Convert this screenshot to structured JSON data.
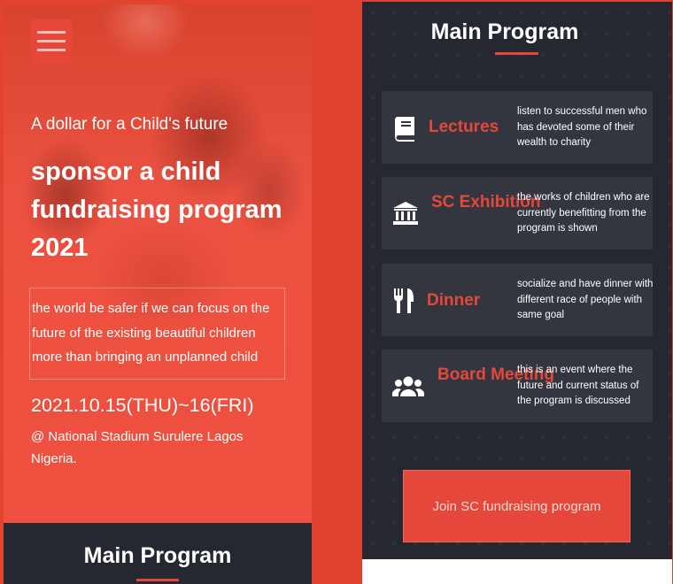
{
  "hero": {
    "tagline": "A dollar for a Child's future",
    "title": "sponsor a child fundraising program 2021",
    "text": "the world be safer if we can focus on the future of the existing beautiful children more than bringing an unplanned child",
    "date": "2021.10.15(THU)~16(FRI)",
    "venue": "@ National Stadium Surulere Lagos Nigeria."
  },
  "left_section": {
    "title": "Main Program"
  },
  "program": {
    "title": "Main Program",
    "items": [
      {
        "name": "Lectures",
        "icon": "book-icon",
        "description": "listen to successful men who has devoted some of their wealth to charity"
      },
      {
        "name": "SC Exhibition",
        "icon": "museum-icon",
        "description": "the works of children who are currently benefitting from the program is shown"
      },
      {
        "name": "Dinner",
        "icon": "utensils-icon",
        "description": "socialize and have dinner with different race of people with same goal"
      },
      {
        "name": "Board Meeting",
        "icon": "users-icon",
        "description": "this is an event where the future and current status of the program is discussed"
      }
    ],
    "join_label": "Join SC fundraising program"
  },
  "colors": {
    "accent": "#e5483b",
    "dark_background": "#252830",
    "card_background": "#33363f"
  }
}
